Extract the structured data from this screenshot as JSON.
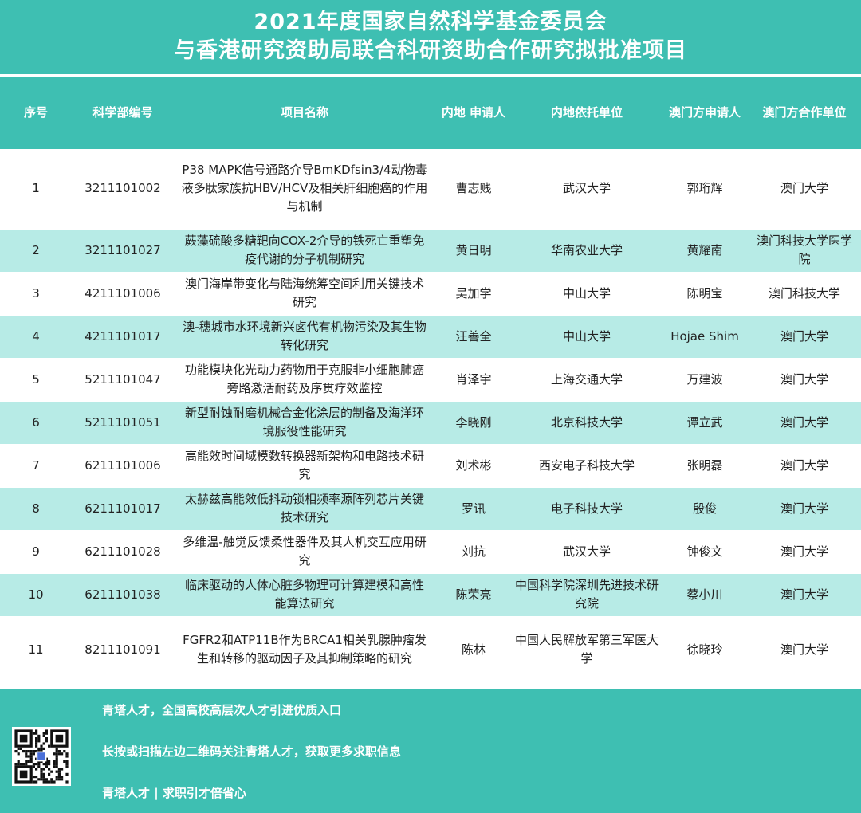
{
  "title": {
    "line1": "2021年度国家自然科学基金委员会",
    "line2": "与香港研究资助局联合科研资助合作研究拟批准项目"
  },
  "table": {
    "headers": [
      "序号",
      "科学部编号",
      "项目名称",
      "内地 申请人",
      "内地依托单位",
      "澳门方申请人",
      "澳门方合作单位"
    ],
    "rows": [
      {
        "no": "1",
        "code": "3211101002",
        "name": "P38 MAPK信号通路介导BmKDfsin3/4动物毒液多肽家族抗HBV/HCV及相关肝细胞癌的作用与机制",
        "applicant": "曹志贱",
        "host": "武汉大学",
        "macau_applicant": "郭珩辉",
        "macau_unit": "澳门大学"
      },
      {
        "no": "2",
        "code": "3211101027",
        "name": "蕨藻硫酸多糖靶向COX-2介导的铁死亡重塑免疫代谢的分子机制研究",
        "applicant": "黄日明",
        "host": "华南农业大学",
        "macau_applicant": "黄耀南",
        "macau_unit": "澳门科技大学医学院"
      },
      {
        "no": "3",
        "code": "4211101006",
        "name": "澳门海岸带变化与陆海统筹空间利用关键技术研究",
        "applicant": "吴加学",
        "host": "中山大学",
        "macau_applicant": "陈明宝",
        "macau_unit": "澳门科技大学"
      },
      {
        "no": "4",
        "code": "4211101017",
        "name": "澳-穗城市水环境新兴卤代有机物污染及其生物转化研究",
        "applicant": "汪善全",
        "host": "中山大学",
        "macau_applicant": "Hojae Shim",
        "macau_unit": "澳门大学"
      },
      {
        "no": "5",
        "code": "5211101047",
        "name": "功能模块化光动力药物用于克服非小细胞肺癌旁路激活耐药及序贯疗效监控",
        "applicant": "肖泽宇",
        "host": "上海交通大学",
        "macau_applicant": "万建波",
        "macau_unit": "澳门大学"
      },
      {
        "no": "6",
        "code": "5211101051",
        "name": "新型耐蚀耐磨机械合金化涂层的制备及海洋环境服役性能研究",
        "applicant": "李晓刚",
        "host": "北京科技大学",
        "macau_applicant": "谭立武",
        "macau_unit": "澳门大学"
      },
      {
        "no": "7",
        "code": "6211101006",
        "name": "高能效时间域模数转换器新架构和电路技术研究",
        "applicant": "刘术彬",
        "host": "西安电子科技大学",
        "macau_applicant": "张明磊",
        "macau_unit": "澳门大学"
      },
      {
        "no": "8",
        "code": "6211101017",
        "name": "太赫兹高能效低抖动锁相频率源阵列芯片关键技术研究",
        "applicant": "罗讯",
        "host": "电子科技大学",
        "macau_applicant": "殷俊",
        "macau_unit": "澳门大学"
      },
      {
        "no": "9",
        "code": "6211101028",
        "name": "多维温-触觉反馈柔性器件及其人机交互应用研究",
        "applicant": "刘抗",
        "host": "武汉大学",
        "macau_applicant": "钟俊文",
        "macau_unit": "澳门大学"
      },
      {
        "no": "10",
        "code": "6211101038",
        "name": "临床驱动的人体心脏多物理可计算建模和高性能算法研究",
        "applicant": "陈荣亮",
        "host": "中国科学院深圳先进技术研究院",
        "macau_applicant": "蔡小川",
        "macau_unit": "澳门大学"
      },
      {
        "no": "11",
        "code": "8211101091",
        "name": "FGFR2和ATP11B作为BRCA1相关乳腺肿瘤发生和转移的驱动因子及其抑制策略的研究",
        "applicant": "陈林",
        "host": "中国人民解放军第三军医大学",
        "macau_applicant": "徐晓玲",
        "macau_unit": "澳门大学"
      }
    ]
  },
  "footer": {
    "line1": "青塔人才，全国高校高层次人才引进优质入口",
    "line2": "长按或扫描左边二维码关注青塔人才，获取更多求职信息",
    "line3": "青塔人才 | 求职引才倍省心"
  },
  "icons": {
    "qr": "qr-code-icon"
  },
  "colors": {
    "header": "#3ebfb2",
    "stripe": "#b7ebe6",
    "text": "#222222"
  }
}
